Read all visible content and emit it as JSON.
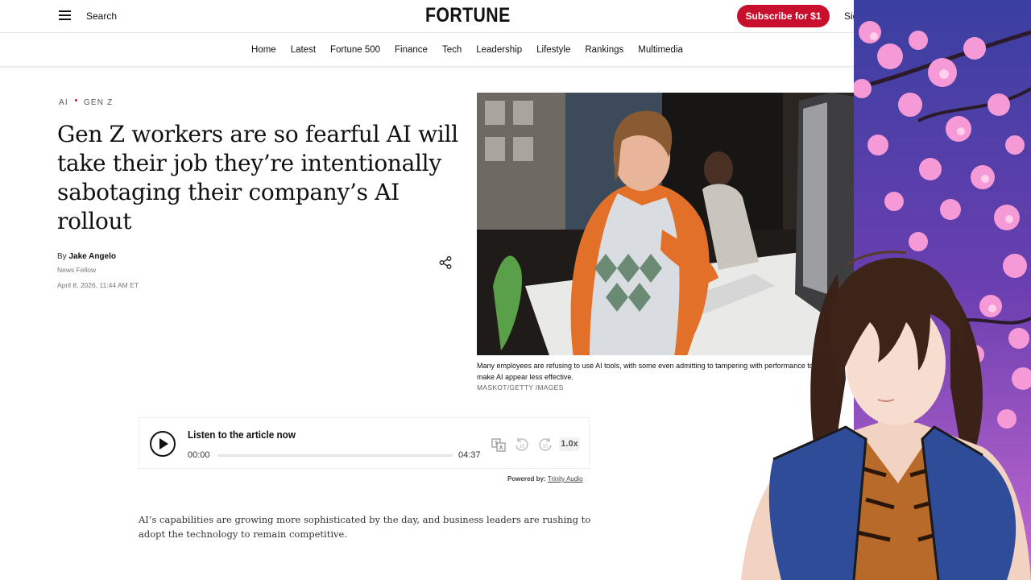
{
  "header": {
    "search_label": "Search",
    "logo": "FORTUNE",
    "subscribe_label": "Subscribe for $1",
    "signin_label": "Sign In"
  },
  "nav": {
    "items": [
      "Home",
      "Latest",
      "Fortune 500",
      "Finance",
      "Tech",
      "Leadership",
      "Lifestyle",
      "Rankings",
      "Multimedia"
    ]
  },
  "article": {
    "tags": [
      "AI",
      "GEN Z"
    ],
    "headline": "Gen Z workers are so fearful AI will take their job they’re intentionally sabotaging their company’s AI rollout",
    "by_prefix": "By",
    "author": "Jake Angelo",
    "author_role": "News Fellow",
    "date": "April 8, 2026, 11:44 AM ET",
    "caption": "Many employees are refusing to use AI tools, with some even admitting to tampering with performance to make AI appear less effective.",
    "credit": "MASKOT/GETTY IMAGES",
    "body": "AI’s capabilities are growing more sophisticated by the day, and business leaders are rushing to adopt the technology to remain competitive."
  },
  "player": {
    "title": "Listen to the article now",
    "current_time": "00:00",
    "total_time": "04:37",
    "progress": 0,
    "speed": "1.0x",
    "powered_prefix": "Powered by:",
    "powered_link": "Trinity Audio"
  },
  "colors": {
    "brand_red": "#c8102e",
    "text": "#111111",
    "muted": "#777777"
  },
  "icons": {
    "menu": "hamburger-icon",
    "share": "share-icon",
    "play": "play-icon",
    "translate": "translate-icon",
    "rewind": "rewind-10-icon",
    "forward": "forward-10-icon"
  }
}
